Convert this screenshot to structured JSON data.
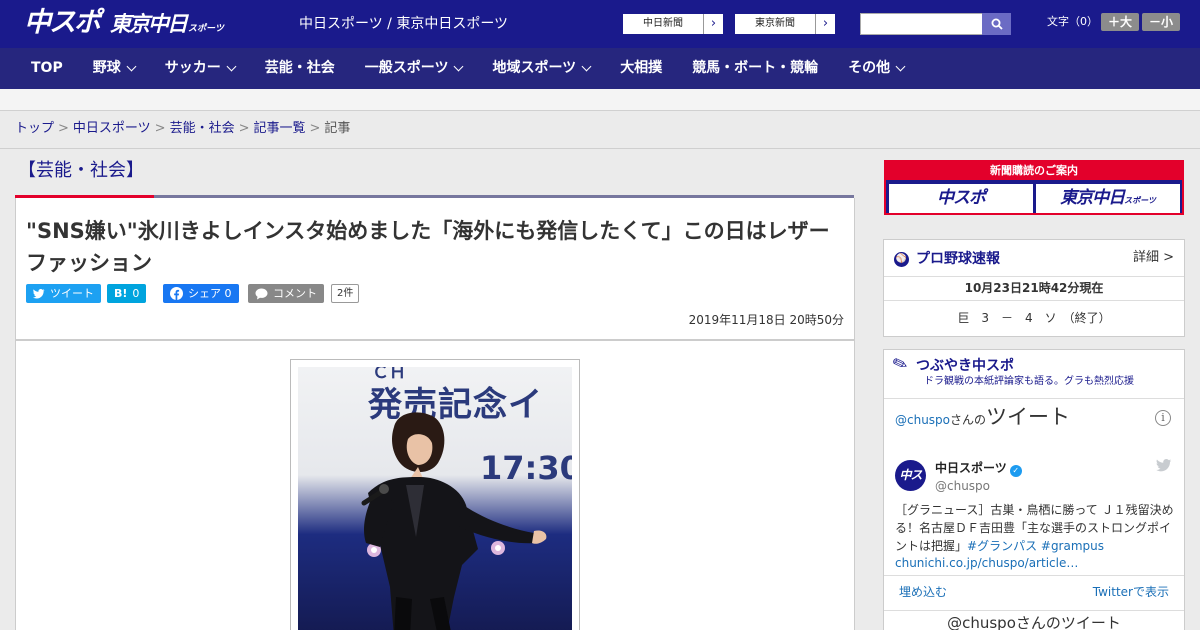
{
  "header": {
    "logo_chuspo": "中スポ",
    "logo_tokyo": "東京中日",
    "logo_tokyo_suffix": "スポーツ",
    "sites_text": "中日スポーツ / 東京中日スポーツ",
    "link_chunichi": "中日新聞",
    "link_tokyo": "東京新聞",
    "search_placeholder": "",
    "font_label": "文字（0）",
    "font_increase": "＋大",
    "font_decrease": "－小"
  },
  "nav": {
    "items": [
      {
        "label": "TOP",
        "has_menu": false
      },
      {
        "label": "野球",
        "has_menu": true
      },
      {
        "label": "サッカー",
        "has_menu": true
      },
      {
        "label": "芸能・社会",
        "has_menu": false
      },
      {
        "label": "一般スポーツ",
        "has_menu": true
      },
      {
        "label": "地域スポーツ",
        "has_menu": true
      },
      {
        "label": "大相撲",
        "has_menu": false
      },
      {
        "label": "競馬・ボート・競輪",
        "has_menu": false
      },
      {
        "label": "その他",
        "has_menu": true
      }
    ]
  },
  "breadcrumb": {
    "items": [
      "トップ",
      "中日スポーツ",
      "芸能・社会",
      "記事一覧"
    ],
    "current": "記事"
  },
  "article": {
    "category": "【芸能・社会】",
    "title": "\"SNS嫌い\"氷川きよしインスタ始めました「海外にも発信したくて」この日はレザーファッション",
    "share": {
      "tweet": "ツイート",
      "hatena": "B!",
      "hatena_count": "0",
      "facebook": "シェア",
      "facebook_count": "0",
      "comment": "コメント",
      "comment_count": "2件"
    },
    "date": "2019年11月18日 20時50分",
    "photo": {
      "banner_line1": "ＣＨ",
      "banner_line2": "発売記念イ",
      "banner_time": "17:30"
    }
  },
  "sidebar": {
    "subscription": {
      "header": "新聞購読のご案内",
      "btn_chuspo": "中スポ",
      "btn_tokyo": "東京中日",
      "btn_tokyo_suffix": "スポーツ"
    },
    "baseball": {
      "title": "プロ野球速報",
      "more": "詳細 >",
      "timestamp": "10月23日21時42分現在",
      "score": "巨　3　－　4　ソ　（終了）"
    },
    "tweets": {
      "title": "つぶやき中スポ",
      "subtitle": "ドラ観戦の本紙評論家も語る。グラも熱烈応援",
      "handle_prefix": "@chuspo",
      "handle_suffix": "さんの",
      "tweet_word": "ツイート",
      "account_name": "中日スポーツ",
      "account_handle": "@chuspo",
      "avatar_text": "中スポ",
      "tweet_text": "［グラニュース］古巣・鳥栖に勝って Ｊ１残留決める！名古屋ＤＦ吉田豊「主な選手のストロングポイントは把握」",
      "tweet_tags": "#グランパス #grampus",
      "tweet_link": "chunichi.co.jp/chuspo/article…",
      "embed": "埋め込む",
      "view_on_twitter": "Twitterで表示",
      "bottom_text": "@chuspoさんのツイート"
    }
  },
  "colors": {
    "brand_navy": "#1a1a8c",
    "nav_bg": "#26267e",
    "accent_red": "#e3002b",
    "twitter_blue": "#1da1f2",
    "hatena_blue": "#00a4de",
    "facebook_blue": "#1877f2",
    "comment_gray": "#888888"
  },
  "icons": {
    "search": "search-icon",
    "twitter": "twitter-bird-icon",
    "facebook": "facebook-icon",
    "comment": "comment-bubble-icon",
    "baseball": "baseball-icon",
    "pen": "pen-icon",
    "info": "info-icon",
    "verified": "verified-badge-icon"
  }
}
